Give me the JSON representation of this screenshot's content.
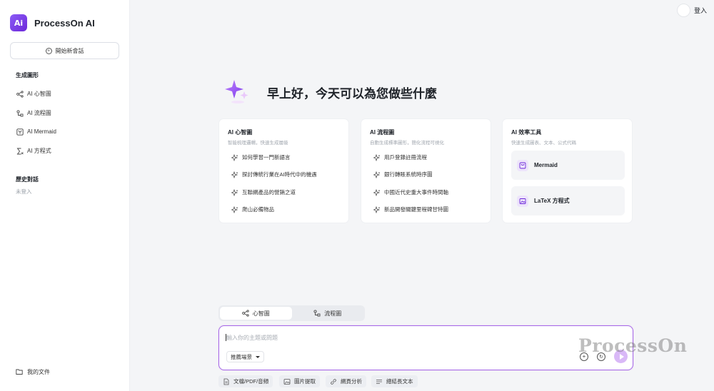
{
  "brand": {
    "logo_text": "Ai",
    "name": "ProcessOn AI"
  },
  "sidebar": {
    "new_chat": "開始新會話",
    "generate_title": "生成圖形",
    "items": [
      {
        "label": "AI 心智圖",
        "icon": "mindmap-icon"
      },
      {
        "label": "AI 流程圖",
        "icon": "flowchart-icon"
      },
      {
        "label": "AI Mermaid",
        "icon": "mermaid-icon"
      },
      {
        "label": "AI 方程式",
        "icon": "equation-icon"
      }
    ],
    "history_title": "歷史對話",
    "history_empty": "未登入",
    "my_files": "我的文件"
  },
  "header": {
    "login": "登入"
  },
  "greeting": "早上好，今天可以為您做些什麼",
  "cards": [
    {
      "title": "AI 心智圖",
      "subtitle": "智能梳理邏輯，快速生成層級",
      "items": [
        "如何學習一門新語言",
        "探討傳統行業在AI時代中的機遇",
        "互聯網產品的營銷之道",
        "爬山必備物品"
      ]
    },
    {
      "title": "AI 流程圖",
      "subtitle": "自動生成標準圖形，簡化流程可視化",
      "items": [
        "用戶登錄註冊流程",
        "銀行轉賬系統時序圖",
        "中國近代史重大事件時間軸",
        "新品開發關鍵里程碑甘特圖"
      ]
    },
    {
      "title": "AI 效率工具",
      "subtitle": "快速生成圖表、文本、公式代碼",
      "tools": [
        "Mermaid",
        "LaTeX 方程式"
      ]
    }
  ],
  "tabs": [
    {
      "label": "心智圖",
      "active": true
    },
    {
      "label": "流程圖",
      "active": false
    }
  ],
  "input": {
    "placeholder": "輸入你的主題或問題",
    "scene": "推薦場景"
  },
  "watermark": "ProcessOn",
  "chips": [
    "文檔/PDF/音頻",
    "圖片提取",
    "網頁分析",
    "總結長文本"
  ],
  "colors": {
    "accent": "#8b5cf6",
    "input_border": "#a66be8",
    "send": "#d9b8f7"
  }
}
